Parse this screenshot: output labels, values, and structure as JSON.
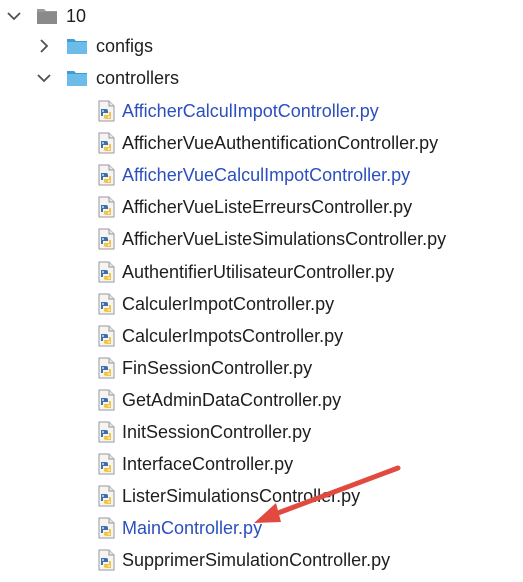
{
  "tree": {
    "root": {
      "label": "10",
      "expanded": true
    },
    "folders": [
      {
        "label": "configs",
        "expanded": false
      },
      {
        "label": "controllers",
        "expanded": true
      }
    ],
    "files": [
      {
        "label": "AfficherCalculImpotController.py",
        "highlight": true
      },
      {
        "label": "AfficherVueAuthentificationController.py",
        "highlight": false
      },
      {
        "label": "AfficherVueCalculImpotController.py",
        "highlight": true
      },
      {
        "label": "AfficherVueListeErreursController.py",
        "highlight": false
      },
      {
        "label": "AfficherVueListeSimulationsController.py",
        "highlight": false
      },
      {
        "label": "AuthentifierUtilisateurController.py",
        "highlight": false
      },
      {
        "label": "CalculerImpotController.py",
        "highlight": false
      },
      {
        "label": "CalculerImpotsController.py",
        "highlight": false
      },
      {
        "label": "FinSessionController.py",
        "highlight": false
      },
      {
        "label": "GetAdminDataController.py",
        "highlight": false
      },
      {
        "label": "InitSessionController.py",
        "highlight": false
      },
      {
        "label": "InterfaceController.py",
        "highlight": false
      },
      {
        "label": "ListerSimulationsController.py",
        "highlight": false
      },
      {
        "label": "MainController.py",
        "highlight": true
      },
      {
        "label": "SupprimerSimulationController.py",
        "highlight": false
      }
    ]
  },
  "colors": {
    "text": "#1e1e1e",
    "highlight_text": "#2b4fbf",
    "folder_light": "#6bbce8",
    "folder_dark": "#3d9bd6",
    "root_folder": "#9a9a9a",
    "arrow": "#e04a3f",
    "python_blue": "#3f6fa8",
    "python_yellow": "#f5c542"
  },
  "icons": {
    "expanded": "chevron-down-icon",
    "collapsed": "chevron-right-icon",
    "folder": "folder-icon",
    "python_file": "python-file-icon",
    "annotation": "red-arrow-annotation"
  }
}
